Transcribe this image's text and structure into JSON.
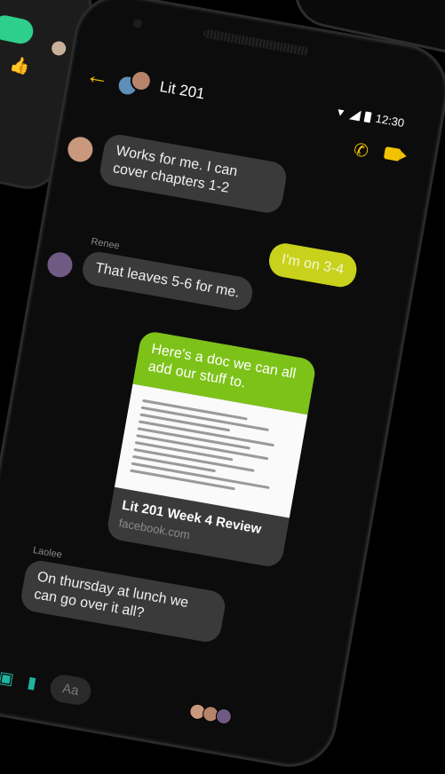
{
  "status": {
    "time": "12:30"
  },
  "header": {
    "title": "Lit 201"
  },
  "messages": {
    "m1": "Works for me. I can cover chapters 1-2",
    "m2": "I'm on 3-4",
    "m3_sender": "Renee",
    "m3": "That leaves 5-6 for me.",
    "share_text": "Here's a doc we can all add our stuff to.",
    "share_title": "Lit 201 Week 4 Review",
    "share_link": "facebook.com",
    "m4_sender": "Laolee",
    "m4": "On thursday at lunch we can go over it all?"
  },
  "composer": {
    "placeholder": "Aa"
  },
  "colors": {
    "accent": "#f2c200",
    "bubble_self": "#c8d21c",
    "share_header": "#7dc218",
    "composer_icon": "#1fb4a0"
  },
  "icons": [
    "back-arrow-icon",
    "phone-icon",
    "video-icon",
    "camera-icon",
    "image-icon",
    "mic-icon"
  ]
}
